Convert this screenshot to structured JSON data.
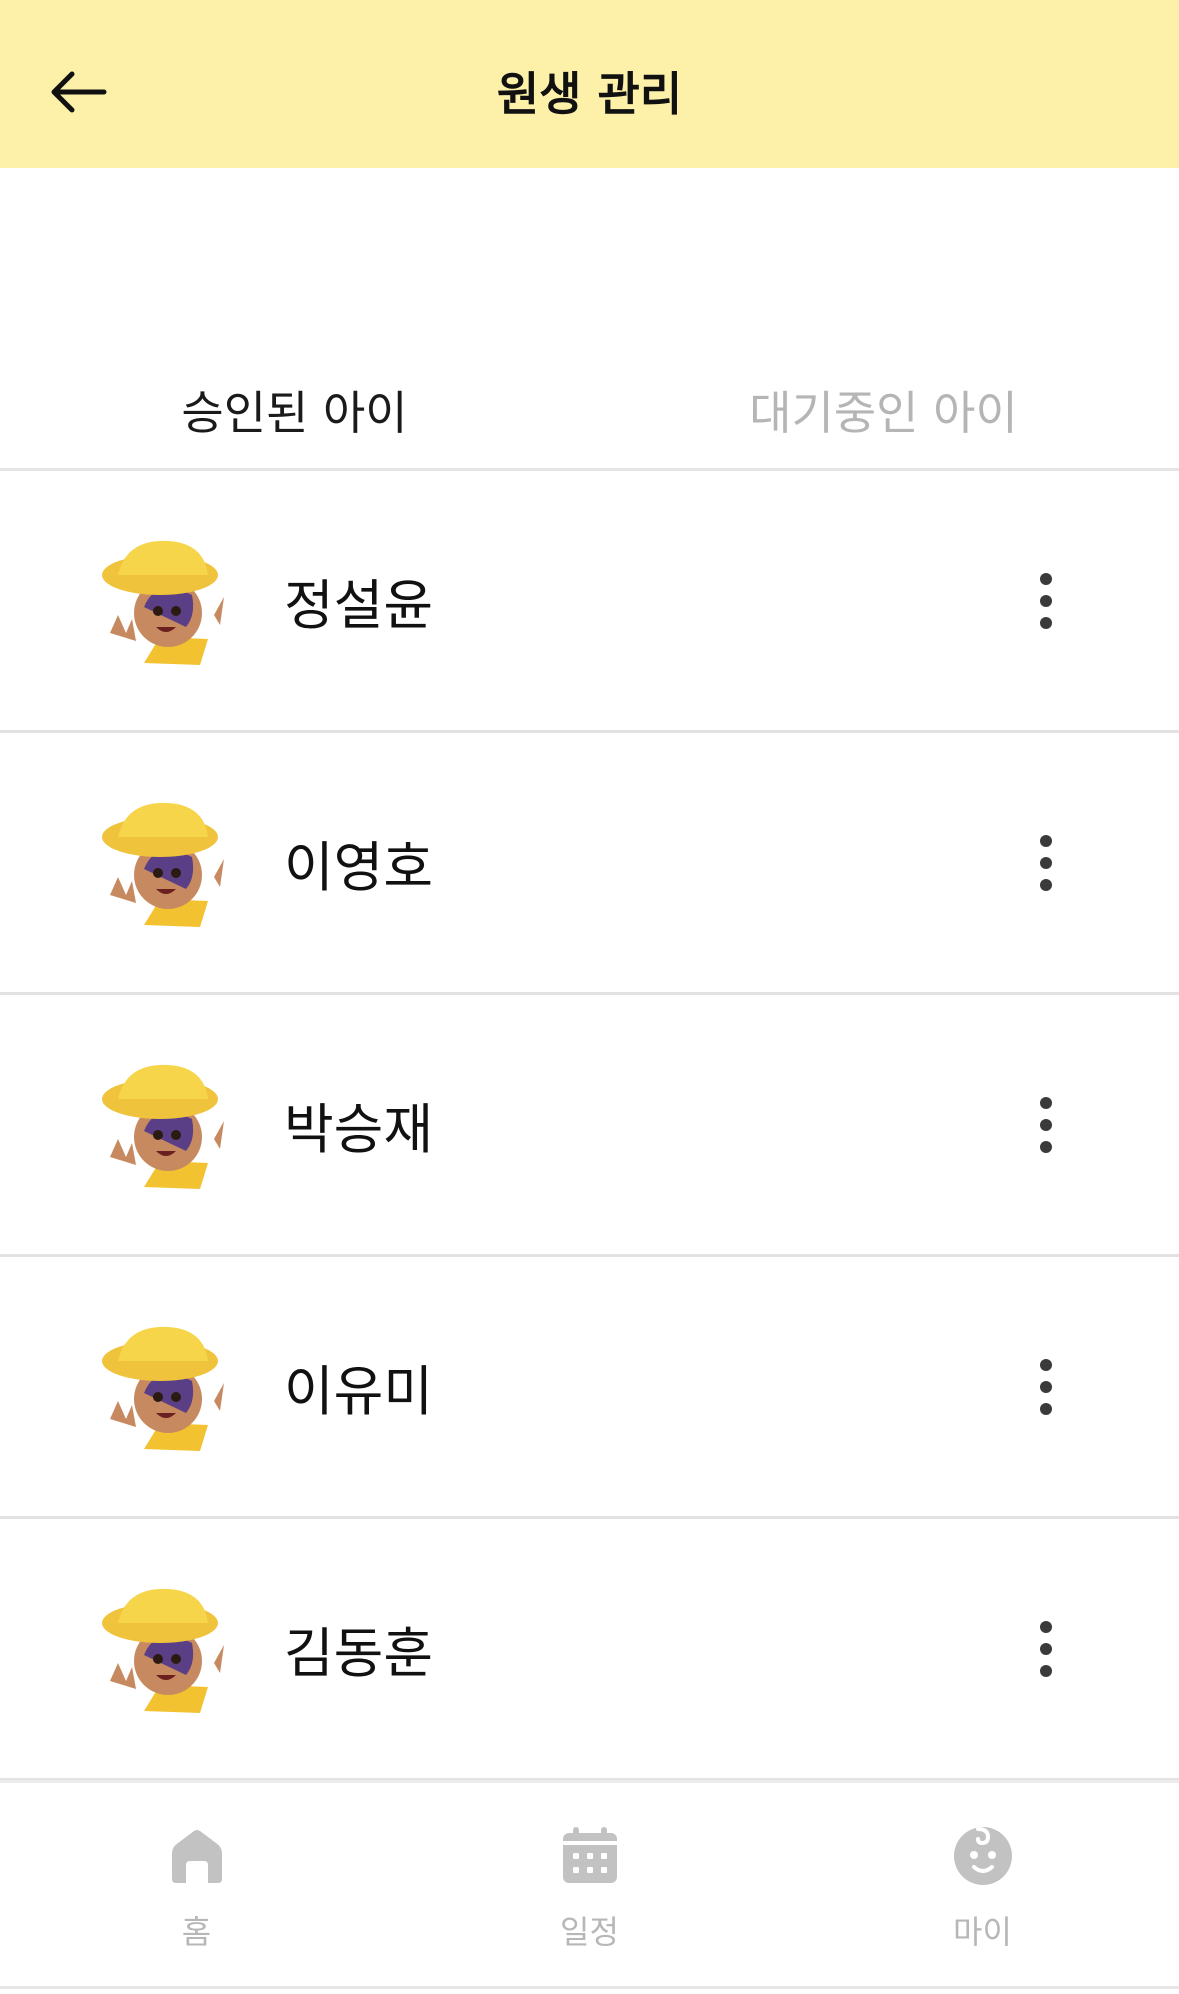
{
  "header": {
    "title": "원생 관리"
  },
  "tabs": [
    {
      "label": "승인된 아이"
    },
    {
      "label": "대기중인 아이"
    }
  ],
  "children": [
    {
      "name": "정설윤"
    },
    {
      "name": "이영호"
    },
    {
      "name": "박승재"
    },
    {
      "name": "이유미"
    },
    {
      "name": "김동훈"
    }
  ],
  "nav": [
    {
      "label": "홈",
      "icon": "home-icon"
    },
    {
      "label": "일정",
      "icon": "calendar-icon"
    },
    {
      "label": "마이",
      "icon": "baby-face-icon"
    }
  ],
  "colors": {
    "header_bg": "#fdf0a9",
    "active_tab": "#1a1a1a",
    "inactive_tab": "#b5b5b5",
    "nav_icon": "#c2c2c2"
  }
}
